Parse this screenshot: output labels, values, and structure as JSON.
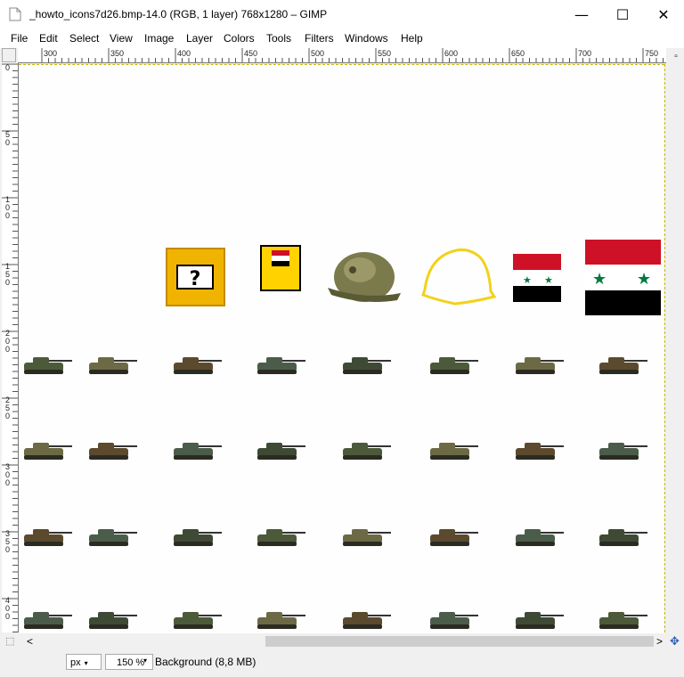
{
  "window": {
    "title": "_howto_icons7d26.bmp-14.0 (RGB, 1 layer) 768x1280 – GIMP",
    "minimize_glyph": "—",
    "maximize_glyph": "☐",
    "close_glyph": "✕"
  },
  "menu": [
    {
      "label": "File"
    },
    {
      "label": "Edit"
    },
    {
      "label": "Select"
    },
    {
      "label": "View"
    },
    {
      "label": "Image"
    },
    {
      "label": "Layer"
    },
    {
      "label": "Colors"
    },
    {
      "label": "Tools"
    },
    {
      "label": "Filters"
    },
    {
      "label": "Windows"
    },
    {
      "label": "Help"
    }
  ],
  "ruler": {
    "h_labels": [
      "300",
      "350",
      "400",
      "450",
      "500",
      "550",
      "600",
      "650",
      "700",
      "750"
    ],
    "v_labels": [
      "0",
      "50",
      "100",
      "150",
      "200",
      "250",
      "300",
      "350",
      "400"
    ]
  },
  "canvas_items": {
    "help_icon_glyph": "?",
    "helmet_icon": "helmet-icon",
    "helmet_outline_icon": "helmet-outline-icon",
    "flag_icon": "syria-flag-icon",
    "tank_icon": "tank-icon"
  },
  "colors": {
    "flag_red": "#ce1126",
    "flag_black": "#000000",
    "flag_green": "#007a3d",
    "help_yellow": "#f0b400",
    "outline_yellow": "#f2d21a",
    "selection": "#c8b400"
  },
  "status": {
    "unit": "px",
    "zoom": "150 %",
    "layer_info": "Background (8,8 MB)"
  },
  "scroll": {
    "left_arrow": "<",
    "right_arrow": ">"
  }
}
